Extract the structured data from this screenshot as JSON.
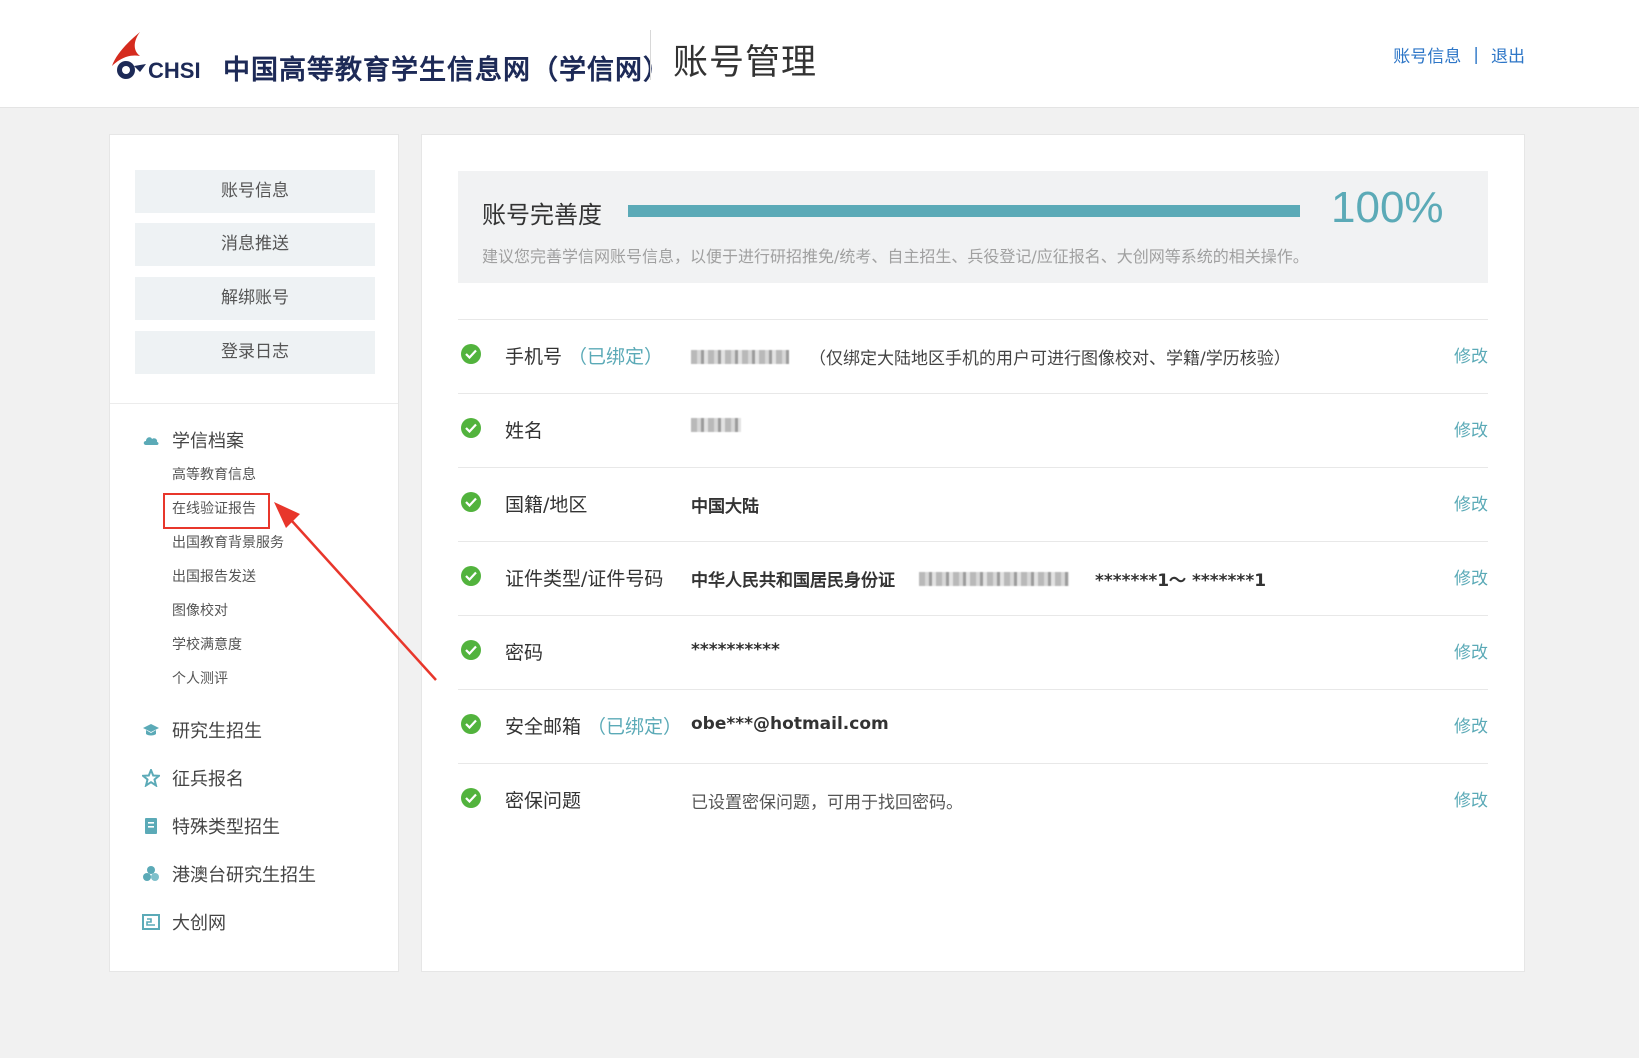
{
  "header": {
    "logo_text": "CHSI",
    "site_name": "中国高等教育学生信息网（学信网）",
    "page_title": "账号管理",
    "links": {
      "account_info": "账号信息",
      "separator": "|",
      "logout": "退出"
    }
  },
  "sidebar": {
    "buttons": [
      "账号信息",
      "消息推送",
      "解绑账号",
      "登录日志"
    ],
    "sections": [
      {
        "label": "学信档案",
        "icon": "cloud-icon",
        "items": [
          "高等教育信息",
          "在线验证报告",
          "出国教育背景服务",
          "出国报告发送",
          "图像校对",
          "学校满意度",
          "个人测评"
        ]
      },
      {
        "label": "研究生招生",
        "icon": "graduation-cap-icon",
        "items": []
      },
      {
        "label": "征兵报名",
        "icon": "star-icon",
        "items": []
      },
      {
        "label": "特殊类型招生",
        "icon": "document-icon",
        "items": []
      },
      {
        "label": "港澳台研究生招生",
        "icon": "cluster-icon",
        "items": []
      },
      {
        "label": "大创网",
        "icon": "grid-icon",
        "items": []
      }
    ],
    "highlighted_item": "在线验证报告"
  },
  "progress": {
    "label": "账号完善度",
    "value": "100%",
    "fraction": 1.0,
    "tip": "建议您完善学信网账号信息，以便于进行研招推免/统考、自主招生、兵役登记/应征报名、大创网等系统的相关操作。"
  },
  "rows": [
    {
      "label": "手机号",
      "bound": "（已绑定）",
      "value": "",
      "note": "（仅绑定大陆地区手机的用户可进行图像校对、学籍/学历核验）",
      "edit": "修改"
    },
    {
      "label": "姓名",
      "bound": "",
      "value": "",
      "edit": "修改"
    },
    {
      "label": "国籍/地区",
      "bound": "",
      "value": "中国大陆",
      "edit": "修改"
    },
    {
      "label": "证件类型/证件号码",
      "bound": "",
      "value": "中华人民共和国居民身份证",
      "extra": "*******1～ *******1",
      "edit": "修改"
    },
    {
      "label": "密码",
      "bound": "",
      "value": "**********",
      "edit": "修改"
    },
    {
      "label": "安全邮箱",
      "bound": "（已绑定）",
      "value": "obe***@hotmail.com",
      "edit": "修改"
    },
    {
      "label": "密保问题",
      "bound": "",
      "value": "已设置密保问题，可用于找回密码。",
      "edit": "修改"
    }
  ],
  "colors": {
    "accent": "#5baab7",
    "link": "#2d76c7",
    "check": "#52b33d",
    "highlight": "#e8362b"
  }
}
